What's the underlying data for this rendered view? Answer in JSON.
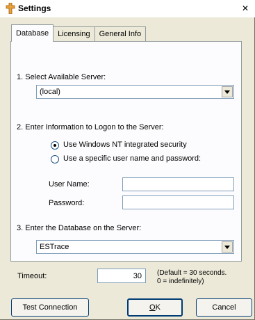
{
  "window": {
    "title": "Settings",
    "close_glyph": "✕",
    "icon": "settings-app-icon"
  },
  "tabs": [
    {
      "label": "Database",
      "active": true
    },
    {
      "label": "Licensing",
      "active": false
    },
    {
      "label": "General Info",
      "active": false
    }
  ],
  "database": {
    "step1_label": "1. Select Available Server:",
    "server_value": "(local)",
    "step2_label": "2. Enter Information to Logon to the Server:",
    "radio_nt": "Use Windows NT integrated security",
    "radio_specific": "Use a specific user name and password:",
    "username_label": "User Name:",
    "username_value": "",
    "password_label": "Password:",
    "password_value": "",
    "step3_label": "3. Enter the Database on the Server:",
    "database_value": "ESTrace"
  },
  "timeout": {
    "label": "Timeout:",
    "value": "30",
    "hint_line1": "(Default = 30 seconds.",
    "hint_line2": "0 = indefinitely)"
  },
  "buttons": {
    "test_connection": "Test Connection",
    "ok": "OK",
    "cancel": "Cancel"
  },
  "colors": {
    "accent": "#003c74",
    "panel": "#fcfcfe",
    "dialog": "#ece9d8"
  }
}
